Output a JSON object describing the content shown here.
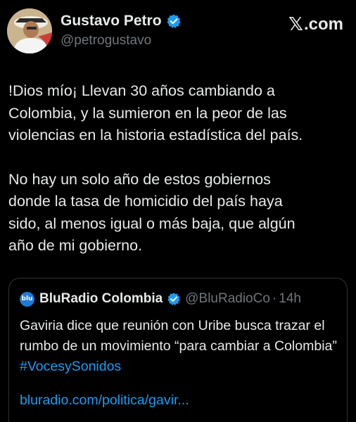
{
  "author": {
    "name": "Gustavo Petro",
    "handle": "@petrogustavo",
    "verified": true
  },
  "brand": {
    "x_glyph": "𝕏",
    "domain": ".com"
  },
  "tweet": {
    "paragraph_1": "!Dios mío¡ Llevan 30 años cambiando a\nColombia, y la sumieron en la peor de las\nviolencias en la historia estadística del país.",
    "paragraph_2": "No hay un solo año de estos gobiernos\ndonde la tasa de homicidio del país haya\nsido, al menos igual o más baja, que algún\naño de mi gobierno."
  },
  "quote": {
    "avatar_text": "blu",
    "name": "BluRadio Colombia",
    "handle": "@BluRadioCo",
    "separator": "·",
    "time": "14h",
    "text": "Gaviria dice que reunión con Uribe busca trazar el rumbo de un movimiento “para cambiar a Colombia” ",
    "hashtag": "#VocesySonidos",
    "link": "bluradio.com/politica/gavir..."
  },
  "colors": {
    "background": "#000000",
    "text": "#e7e9ea",
    "secondary": "#71767b",
    "link": "#1d9bf0",
    "verified_badge": "#1d9bf0",
    "border": "#2f3336"
  }
}
